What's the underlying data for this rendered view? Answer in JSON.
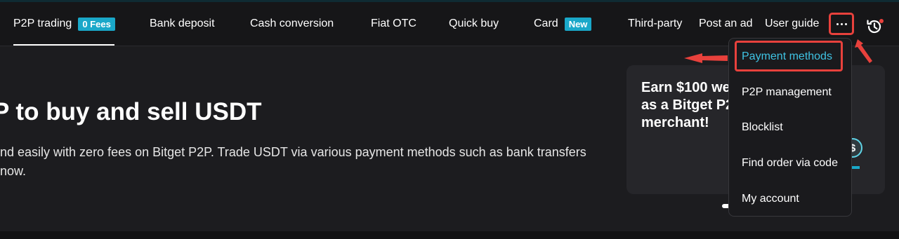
{
  "nav": {
    "items": [
      {
        "label": "P2P trading",
        "badge": "0 Fees"
      },
      {
        "label": "Bank deposit"
      },
      {
        "label": "Cash conversion"
      },
      {
        "label": "Fiat OTC"
      },
      {
        "label": "Quick buy"
      },
      {
        "label": "Card",
        "badge": "New"
      },
      {
        "label": "Third-party"
      },
      {
        "label": "Post an ad"
      },
      {
        "label": "User guide"
      }
    ],
    "more_label": "···",
    "active_index": 0
  },
  "hero": {
    "title": "P to buy and sell USDT",
    "description_line1": "nd easily with zero fees on Bitget P2P. Trade USDT via various payment methods such as bank transfers",
    "description_line2": "now."
  },
  "promo": {
    "title_line1": "Earn $100 we",
    "title_line2": "as a Bitget P2",
    "title_line3": "merchant!",
    "coin_symbol": "$"
  },
  "dropdown": {
    "items": [
      {
        "label": "Payment methods"
      },
      {
        "label": "P2P management"
      },
      {
        "label": "Blocklist"
      },
      {
        "label": "Find order via code"
      },
      {
        "label": "My account"
      }
    ]
  },
  "colors": {
    "accent": "#1aa8c9",
    "highlight": "#e8413c",
    "active_menu_text": "#3fc3e3",
    "background": "#1c1c1f"
  }
}
